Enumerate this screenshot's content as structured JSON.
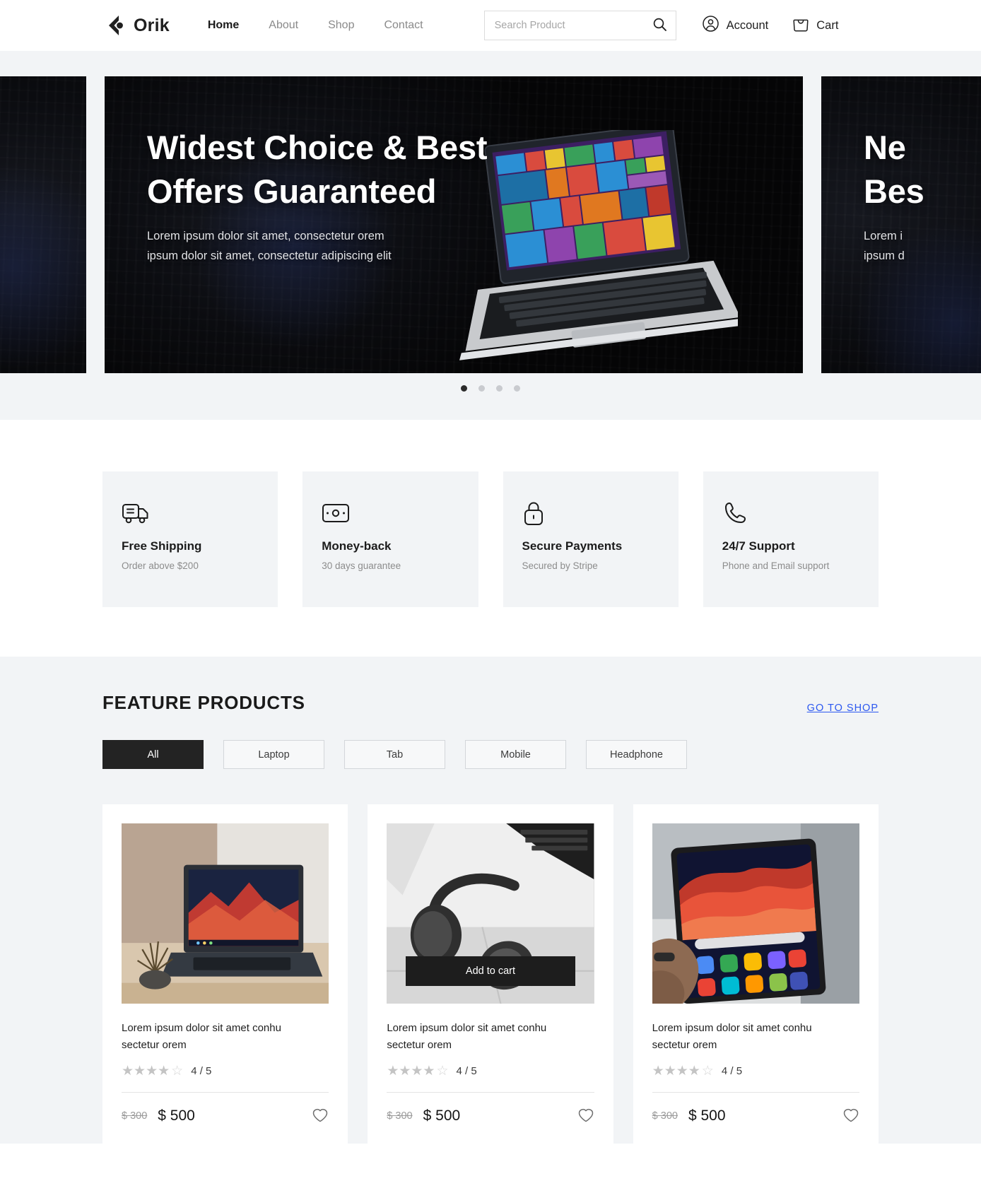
{
  "header": {
    "brand": "Orik",
    "brand_logo_icon": "orik-crescent-logo",
    "nav": [
      {
        "label": "Home",
        "active": true
      },
      {
        "label": "About",
        "active": false
      },
      {
        "label": "Shop",
        "active": false
      },
      {
        "label": "Contact",
        "active": false
      }
    ],
    "search": {
      "placeholder": "Search Product",
      "value": "",
      "icon": "search-icon"
    },
    "actions": [
      {
        "label": "Account",
        "icon": "user-circle-icon"
      },
      {
        "label": "Cart",
        "icon": "shopping-bag-icon"
      }
    ]
  },
  "hero": {
    "slides": [
      {
        "title": "Widest Choice & Best\nOffers Guaranteed",
        "desc": "Lorem ipsum dolor sit amet, consectetur orem\nipsum dolor sit amet, consectetur adipiscing elit"
      },
      {
        "title": "Ne\nBes",
        "desc": "Lorem i\nipsum d"
      }
    ],
    "dots": [
      {
        "active": true
      },
      {
        "active": false
      },
      {
        "active": false
      },
      {
        "active": false
      }
    ]
  },
  "features": [
    {
      "icon": "delivery-truck-icon",
      "title": "Free Shipping",
      "subtitle": "Order above $200"
    },
    {
      "icon": "banknote-icon",
      "title": "Money-back",
      "subtitle": "30 days guarantee"
    },
    {
      "icon": "lock-icon",
      "title": "Secure Payments",
      "subtitle": "Secured by Stripe"
    },
    {
      "icon": "phone-icon",
      "title": "24/7 Support",
      "subtitle": "Phone and Email support"
    }
  ],
  "products_section": {
    "title": "FEATURE PRODUCTS",
    "goto_shop": "GO TO SHOP",
    "goto_shop_color": "#2b57f0",
    "filters": [
      {
        "label": "All",
        "active": true
      },
      {
        "label": "Laptop",
        "active": false
      },
      {
        "label": "Tab",
        "active": false
      },
      {
        "label": "Mobile",
        "active": false
      },
      {
        "label": "Headphone",
        "active": false
      }
    ],
    "add_to_cart_label": "Add to cart",
    "products": [
      {
        "image": "laptop-on-desk",
        "name": "Lorem ipsum dolor sit amet conhu\nsectetur orem",
        "rating": "4 / 5",
        "stars_filled": 4,
        "stars_total": 5,
        "price_old": "$ 300",
        "price_new": "$ 500",
        "hovered": false
      },
      {
        "image": "headphones-on-marble",
        "name": "Lorem ipsum dolor sit amet conhu\nsectetur orem",
        "rating": "4 / 5",
        "stars_filled": 4,
        "stars_total": 5,
        "price_old": "$ 300",
        "price_new": "$ 500",
        "hovered": true
      },
      {
        "image": "tablet-in-hand",
        "name": "Lorem ipsum dolor sit amet conhu\nsectetur orem",
        "rating": "4 / 5",
        "stars_filled": 4,
        "stars_total": 5,
        "price_old": "$ 300",
        "price_new": "$ 500",
        "hovered": false
      }
    ]
  }
}
